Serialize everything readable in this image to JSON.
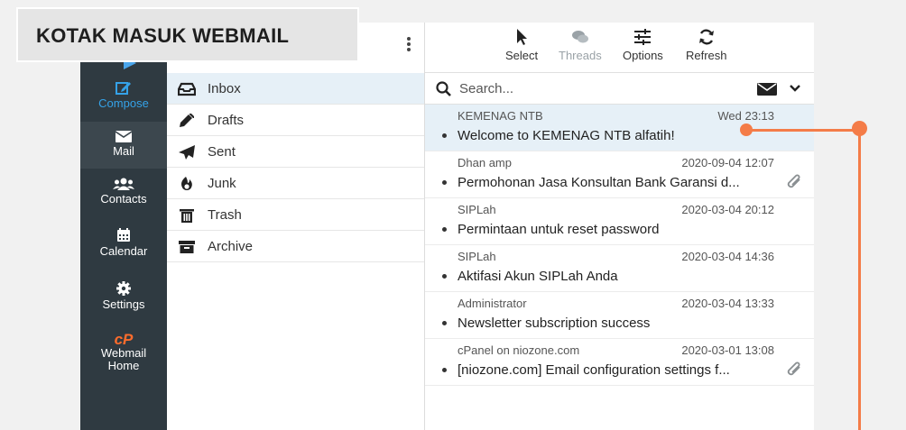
{
  "overlay": {
    "title": "KOTAK MASUK WEBMAIL"
  },
  "rail": {
    "items": [
      {
        "label": "Compose",
        "icon": "compose-icon"
      },
      {
        "label": "Mail",
        "icon": "envelope-icon"
      },
      {
        "label": "Contacts",
        "icon": "contacts-icon"
      },
      {
        "label": "Calendar",
        "icon": "calendar-icon"
      },
      {
        "label": "Settings",
        "icon": "gear-icon"
      },
      {
        "logo": "cP",
        "label_line1": "Webmail",
        "label_line2": "Home",
        "icon": "cpanel-logo"
      }
    ]
  },
  "folders": [
    {
      "label": "Inbox",
      "icon": "inbox-icon"
    },
    {
      "label": "Drafts",
      "icon": "pencil-icon"
    },
    {
      "label": "Sent",
      "icon": "paper-plane-icon"
    },
    {
      "label": "Junk",
      "icon": "fire-icon"
    },
    {
      "label": "Trash",
      "icon": "trash-icon"
    },
    {
      "label": "Archive",
      "icon": "archive-icon"
    }
  ],
  "toolbar": {
    "select": "Select",
    "threads": "Threads",
    "options": "Options",
    "refresh": "Refresh"
  },
  "search": {
    "placeholder": "Search..."
  },
  "messages": [
    {
      "from": "KEMENAG NTB",
      "date": "Wed 23:13",
      "subject": "Welcome to KEMENAG NTB alfatih!",
      "attachment": false
    },
    {
      "from": "Dhan amp",
      "date": "2020-09-04 12:07",
      "subject": "Permohonan Jasa Konsultan Bank Garansi d...",
      "attachment": true
    },
    {
      "from": "SIPLah",
      "date": "2020-03-04 20:12",
      "subject": "Permintaan untuk reset password",
      "attachment": false
    },
    {
      "from": "SIPLah",
      "date": "2020-03-04 14:36",
      "subject": "Aktifasi Akun SIPLah Anda",
      "attachment": false
    },
    {
      "from": "Administrator",
      "date": "2020-03-04 13:33",
      "subject": "Newsletter subscription success",
      "attachment": false
    },
    {
      "from": "cPanel on niozone.com",
      "date": "2020-03-01 13:08",
      "subject": "[niozone.com] Email configuration settings f...",
      "attachment": true
    }
  ],
  "colors": {
    "accent": "#35a2e8",
    "rail_bg": "#2f3a41",
    "selected_bg": "#e6f0f7",
    "annotation": "#f47c48",
    "cpanel": "#ff6c2c"
  }
}
